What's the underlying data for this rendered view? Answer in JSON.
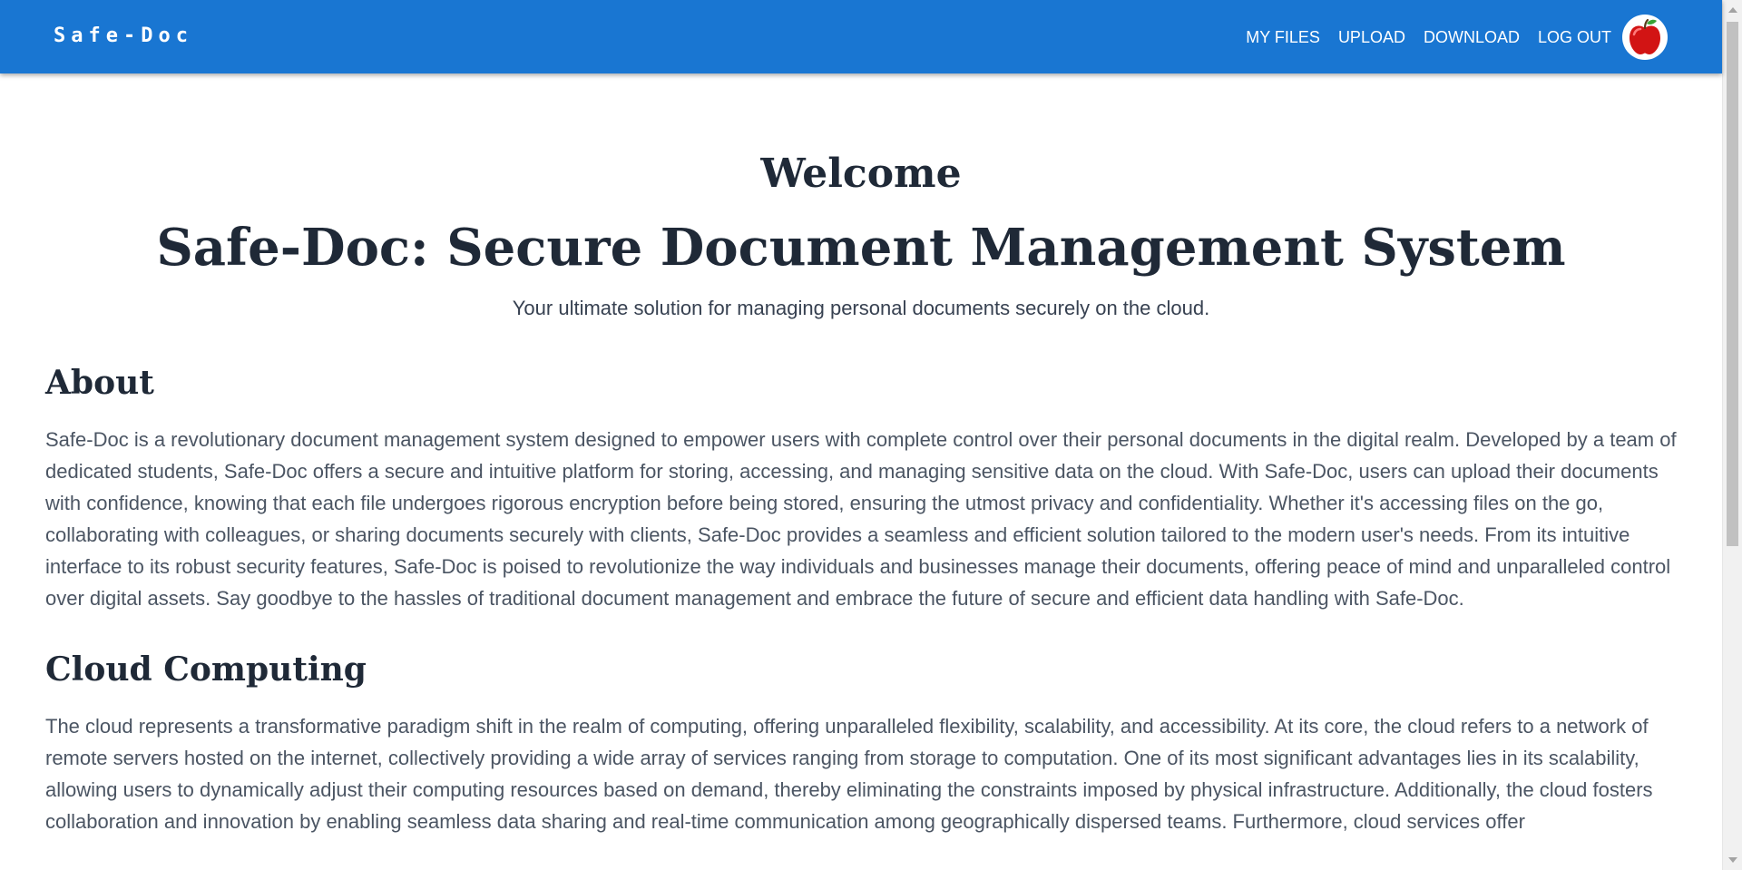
{
  "navbar": {
    "brand": "Safe-Doc",
    "links": {
      "my_files": "MY FILES",
      "upload": "UPLOAD",
      "download": "DOWNLOAD",
      "logout": "LOG OUT"
    },
    "avatar_icon": "apple-icon",
    "color": "#1976d2"
  },
  "hero": {
    "welcome": "Welcome",
    "title": "Safe-Doc: Secure Document Management System",
    "tagline": "Your ultimate solution for managing personal documents securely on the cloud."
  },
  "about": {
    "heading": "About",
    "text": "Safe-Doc is a revolutionary document management system designed to empower users with complete control over their personal documents in the digital realm. Developed by a team of dedicated students, Safe-Doc offers a secure and intuitive platform for storing, accessing, and managing sensitive data on the cloud. With Safe-Doc, users can upload their documents with confidence, knowing that each file undergoes rigorous encryption before being stored, ensuring the utmost privacy and confidentiality. Whether it's accessing files on the go, collaborating with colleagues, or sharing documents securely with clients, Safe-Doc provides a seamless and efficient solution tailored to the modern user's needs. From its intuitive interface to its robust security features, Safe-Doc is poised to revolutionize the way individuals and businesses manage their documents, offering peace of mind and unparalleled control over digital assets. Say goodbye to the hassles of traditional document management and embrace the future of secure and efficient data handling with Safe-Doc."
  },
  "cloud": {
    "heading": "Cloud Computing",
    "text": "The cloud represents a transformative paradigm shift in the realm of computing, offering unparalleled flexibility, scalability, and accessibility. At its core, the cloud refers to a network of remote servers hosted on the internet, collectively providing a wide array of services ranging from storage to computation. One of its most significant advantages lies in its scalability, allowing users to dynamically adjust their computing resources based on demand, thereby eliminating the constraints imposed by physical infrastructure. Additionally, the cloud fosters collaboration and innovation by enabling seamless data sharing and real-time communication among geographically dispersed teams. Furthermore, cloud services offer"
  }
}
